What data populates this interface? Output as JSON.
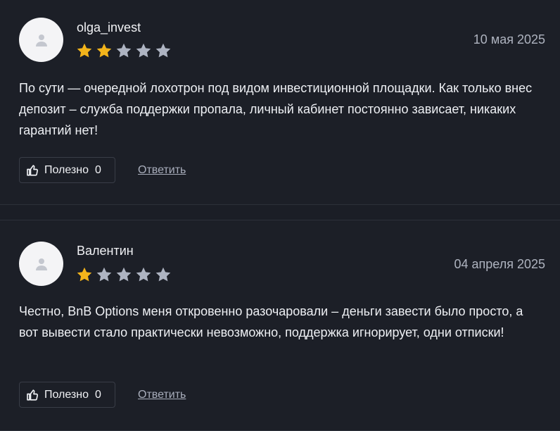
{
  "reviews": [
    {
      "author": "olga_invest",
      "date": "10 мая 2025",
      "rating": 2,
      "text": "По сути — очередной лохотрон под видом инвестиционной площадки. Как только внес депозит – служба поддержки пропала, личный кабинет постоянно зависает, никаких гарантий нет!",
      "useful_label": "Полезно",
      "useful_count": "0",
      "reply_label": "Ответить"
    },
    {
      "author": "Валентин",
      "date": "04 апреля 2025",
      "rating": 1,
      "text": "Честно, BnB Options меня откровенно разочаровали – деньги завести было просто, а вот вывести стало практически невозможно, поддержка игнорирует, одни отписки!",
      "useful_label": "Полезно",
      "useful_count": "0",
      "reply_label": "Ответить"
    }
  ],
  "colors": {
    "star_filled": "#f3b41b",
    "star_empty": "#aeb4c2"
  },
  "icons": {
    "avatar": "user-icon",
    "useful": "thumbs-up-icon",
    "rating": "star-icon"
  }
}
